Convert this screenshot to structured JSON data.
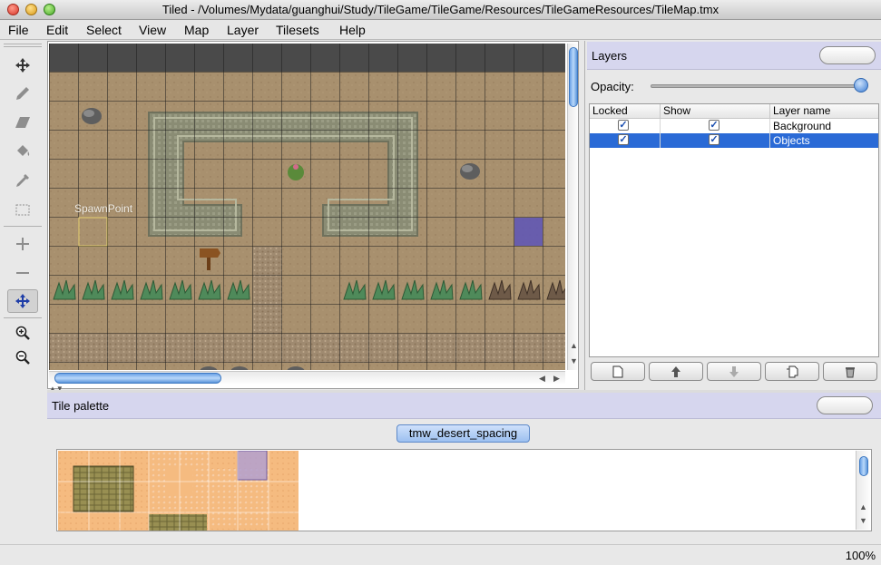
{
  "window": {
    "title": "Tiled - /Volumes/Mydata/guanghui/Study/TileGame/TileGame/Resources/TileGameResources/TileMap.tmx"
  },
  "menubar": [
    "File",
    "Edit",
    "Select",
    "View",
    "Map",
    "Layer",
    "Tilesets",
    "Help"
  ],
  "toolbar": {
    "tools": [
      "move-icon",
      "stamp-brush-icon",
      "eraser-icon",
      "bucket-fill-icon",
      "eyedropper-icon",
      "rectangle-select-icon",
      "add-icon",
      "remove-icon",
      "object-select-icon",
      "zoom-in-icon",
      "zoom-out-icon"
    ]
  },
  "map": {
    "object_label": "SpawnPoint"
  },
  "layers_panel": {
    "title": "Layers",
    "opacity_label": "Opacity:",
    "opacity_value": 1.0,
    "columns": [
      "Locked",
      "Show",
      "Layer name"
    ],
    "layers": [
      {
        "name": "Background",
        "locked": true,
        "show": true,
        "selected": false
      },
      {
        "name": "Objects",
        "locked": true,
        "show": true,
        "selected": true
      }
    ],
    "buttons": [
      "new-layer-icon",
      "move-layer-up-icon",
      "move-layer-down-icon",
      "duplicate-layer-icon",
      "delete-layer-icon"
    ]
  },
  "tile_palette": {
    "title": "Tile palette",
    "tileset_tab": "tmw_desert_spacing"
  },
  "status": {
    "zoom": "100%"
  },
  "colors": {
    "panel_header": "#d6d6ee",
    "selection": "#2a6ad6",
    "sand": "#a58b6a"
  }
}
